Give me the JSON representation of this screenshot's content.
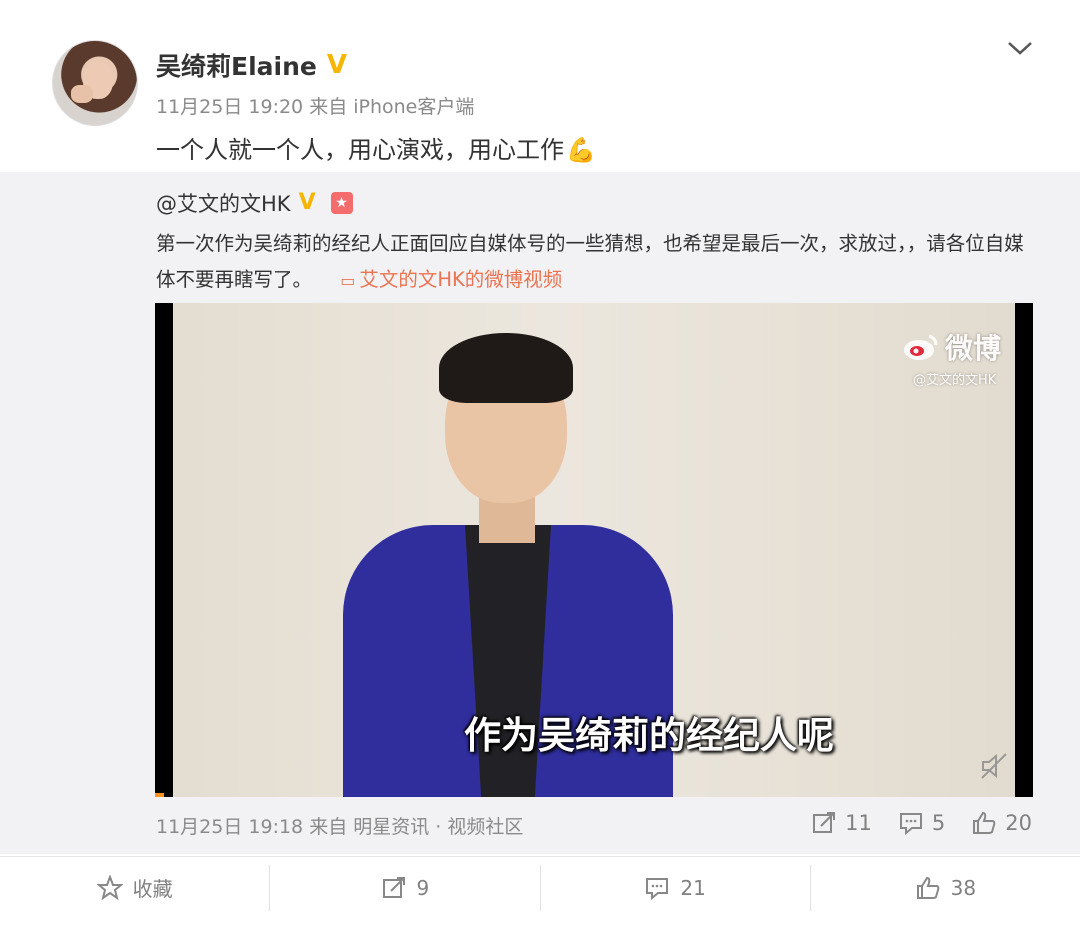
{
  "post": {
    "author": "吴绮莉Elaine",
    "meta": "11月25日 19:20 来自 iPhone客户端",
    "text": "一个人就一个人，用心演戏，用心工作",
    "emoji": "💪"
  },
  "repost": {
    "author": "@艾文的文HK",
    "text": "第一次作为吴绮莉的经纪人正面回应自媒体号的一些猜想，也希望是最后一次，求放过，，请各位自媒体不要再瞎写了。",
    "video_link": "艾文的文HK的微博视频",
    "video": {
      "subtitle": "作为吴绮莉的经纪人呢",
      "watermark_logo": "微博",
      "watermark_handle": "@艾文的文HK",
      "progress": 0.01
    },
    "meta": "11月25日 19:18 来自 明星资讯 · 视频社区",
    "stats": {
      "reposts": "11",
      "comments": "5",
      "likes": "20"
    }
  },
  "actions": {
    "favorite": "收藏",
    "reposts": "9",
    "comments": "21",
    "likes": "38"
  },
  "colors": {
    "verified": "#f7b500",
    "link": "#eb7350",
    "repost_bg": "#f2f2f5",
    "jacket": "#2f2e9c",
    "progress": "#f7931e"
  }
}
